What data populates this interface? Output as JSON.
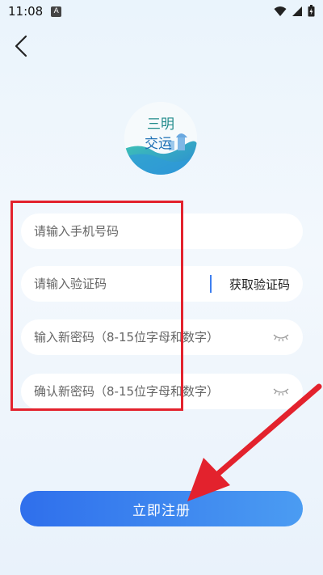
{
  "status_bar": {
    "time": "11:08",
    "notification_badge": "A"
  },
  "icons": [
    "back-icon",
    "wifi-icon",
    "signal-icon",
    "battery-icon",
    "eye-closed-icon",
    "logo-icon"
  ],
  "logo": {
    "line1": "三明",
    "line2": "交运"
  },
  "form": {
    "phone_placeholder": "请输入手机号码",
    "code_placeholder": "请输入验证码",
    "get_code_label": "获取验证码",
    "new_password_placeholder": "输入新密码（8-15位字母和数字）",
    "confirm_password_placeholder": "确认新密码（8-15位字母和数字）"
  },
  "register_label": "立即注册",
  "colors": {
    "primary": "#2f6fec",
    "primary_light": "#4b9cf2",
    "highlight": "#e3222d",
    "background": "#eaf4fc"
  }
}
